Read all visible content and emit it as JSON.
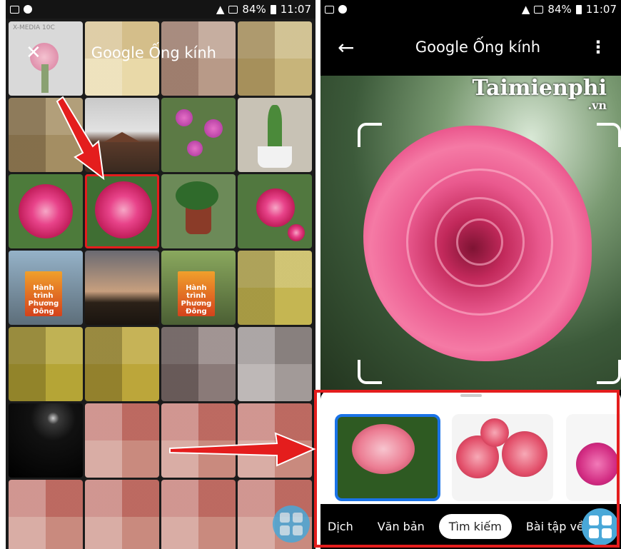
{
  "status_bar": {
    "battery": "84%",
    "time": "11:07"
  },
  "gallery": {
    "title": "Google Ống kính",
    "close_icon": "close-icon",
    "tile_overlay_text": "X-MEDIA 10C",
    "book_text": "Hành trình Phương Đông",
    "fab_icon": "apps-grid-icon"
  },
  "lens": {
    "title": "Google Ống kính",
    "back_icon": "arrow-back-icon",
    "menu_icon": "more-vert-icon",
    "watermark": "Taimienphi",
    "watermark_suffix": ".vn",
    "tabs": [
      {
        "label": "Dịch",
        "selected": false
      },
      {
        "label": "Văn bản",
        "selected": false
      },
      {
        "label": "Tìm kiếm",
        "selected": true
      },
      {
        "label": "Bài tập về nhà",
        "selected": false
      }
    ]
  },
  "colors": {
    "highlight": "#e41d1d",
    "fab": "#4aa8d8",
    "selected_result": "#1a73e8"
  }
}
